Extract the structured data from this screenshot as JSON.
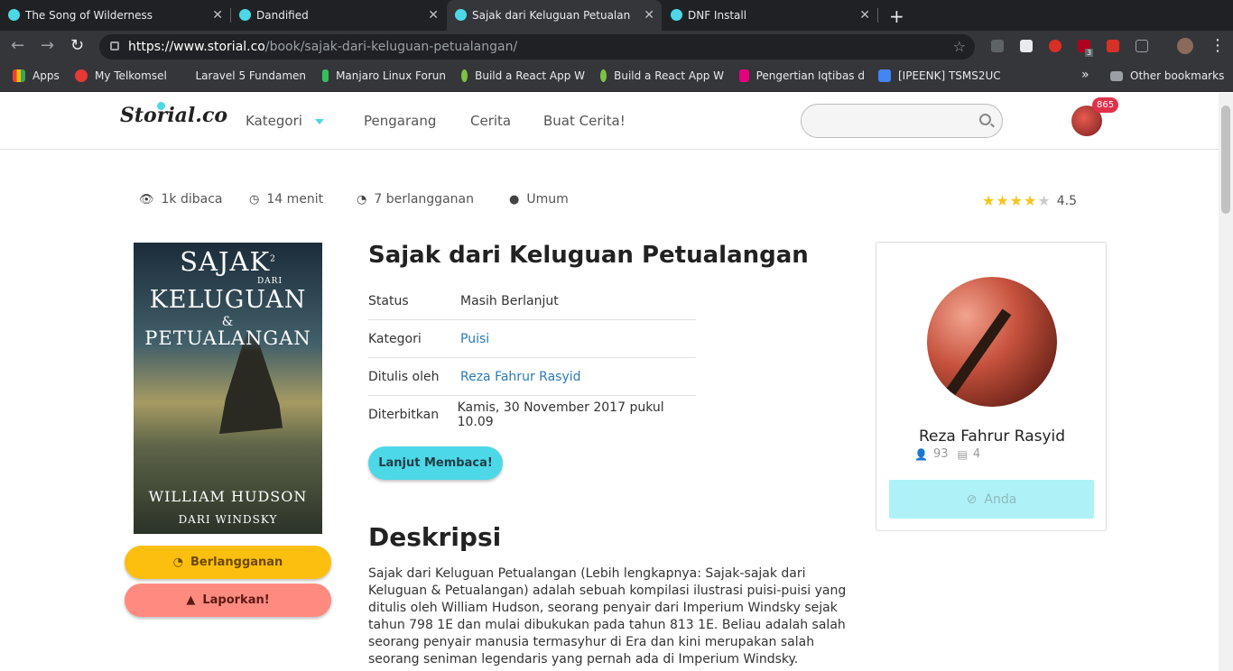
{
  "browser": {
    "tabs": [
      {
        "title": "The Song of Wilderness"
      },
      {
        "title": "Dandified"
      },
      {
        "title": "Sajak dari Keluguan Petualangan"
      },
      {
        "title": "DNF Install"
      }
    ],
    "url_host": "https://www.storial.co",
    "url_path": "/book/sajak-dari-keluguan-petualangan/",
    "bookmarks": [
      {
        "label": "Apps"
      },
      {
        "label": "My Telkomsel"
      },
      {
        "label": "Laravel 5 Fundamen"
      },
      {
        "label": "Manjaro Linux Forun"
      },
      {
        "label": "Build a React App W"
      },
      {
        "label": "Build a React App W"
      },
      {
        "label": "Pengertian Iqtibas d"
      },
      {
        "label": "[IPEENK] TSMS2UC"
      },
      {
        "label": "Other bookmarks"
      }
    ],
    "ext_badge": "3"
  },
  "site": {
    "logo": "Storial.co",
    "nav": [
      "Kategori",
      "Pengarang",
      "Cerita",
      "Buat Cerita!"
    ],
    "search_placeholder": "",
    "notif_count": "865"
  },
  "book": {
    "reads": "1k dibaca",
    "duration": "14 menit",
    "subscribers": "7 berlangganan",
    "visibility": "Umum",
    "rating": "4.5",
    "rating_value": 4.5,
    "title": "Sajak dari Keluguan Petualangan",
    "cover": {
      "line1": "Sajak",
      "sup": "2",
      "dari": "dari",
      "line2": "Keluguan",
      "amp": "&",
      "line3": "Petualangan",
      "author": "William Hudson",
      "from": "dari Windsky"
    },
    "details": [
      {
        "key": "Status",
        "value": "Masih Berlanjut"
      },
      {
        "key": "Kategori",
        "value": "Puisi"
      },
      {
        "key": "Ditulis oleh",
        "value": "Reza Fahrur Rasyid"
      },
      {
        "key": "Diterbitkan",
        "value": "Kamis, 30 November 2017 pukul 10.09"
      }
    ],
    "subscribe_label": "Berlangganan",
    "report_label": "Laporkan!",
    "read_label": "Lanjut Membaca!",
    "desc_heading": "Deskripsi",
    "description": "Sajak dari Keluguan Petualangan (Lebih lengkapnya: Sajak-sajak dari Keluguan & Petualangan) adalah sebuah kompilasi ilustrasi puisi-puisi yang ditulis oleh William Hudson, seorang penyair dari Imperium Windsky sejak tahun 798 1E dan mulai dibukukan pada tahun 813 1E. Beliau adalah salah seorang penyair manusia termasyhur di Era dan kini merupakan salah seorang seniman legendaris yang pernah ada di Imperium Windsky."
  },
  "author": {
    "name": "Reza Fahrur Rasyid",
    "followers": "93",
    "books": "4",
    "button_label": "Anda"
  }
}
